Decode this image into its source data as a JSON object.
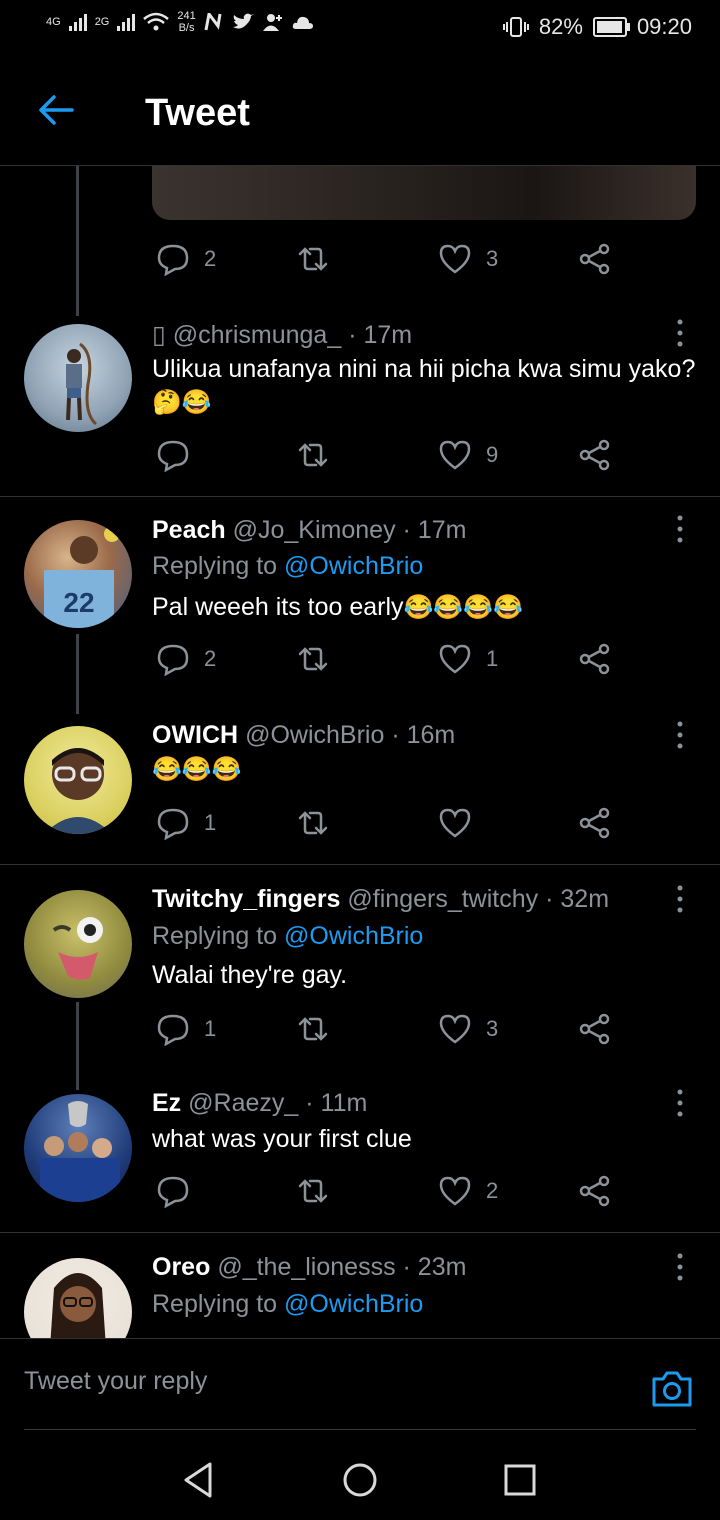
{
  "status_bar": {
    "network1": "4G",
    "network2": "2G",
    "data_rate": "241",
    "data_unit": "B/s",
    "battery": "82%",
    "time": "09:20"
  },
  "header": {
    "title": "Tweet"
  },
  "top_tweet_actions": {
    "replies": "2",
    "likes": "3"
  },
  "tweets": [
    {
      "name": "",
      "handle": "@chrismunga_",
      "prefix": "▯",
      "time": "· 17m",
      "replying_label": "",
      "replying_handle": "",
      "text": "Ulikua unafanya nini na hii picha kwa simu yako?",
      "emoji": "🤔😂",
      "replies": "",
      "likes": "9"
    },
    {
      "name": "Peach",
      "handle": "@Jo_Kimoney",
      "time": "· 17m",
      "replying_label": "Replying to",
      "replying_handle": "@OwichBrio",
      "text": "Pal weeeh its too early",
      "emoji": "😂😂😂😂",
      "replies": "2",
      "likes": "1"
    },
    {
      "name": "OWICH",
      "handle": "@OwichBrio",
      "time": "· 16m",
      "replying_label": "",
      "replying_handle": "",
      "text": "",
      "emoji": "😂😂😂",
      "replies": "1",
      "likes": ""
    },
    {
      "name": "Twitchy_fingers",
      "handle": "@fingers_twitchy",
      "time": "· 32m",
      "replying_label": "Replying to",
      "replying_handle": "@OwichBrio",
      "text": "Walai they're gay.",
      "emoji": "",
      "replies": "1",
      "likes": "3"
    },
    {
      "name": "Ez",
      "handle": "@Raezy_",
      "time": "· 11m",
      "replying_label": "",
      "replying_handle": "",
      "text": "what was your first clue",
      "emoji": "",
      "replies": "",
      "likes": "2"
    },
    {
      "name": "Oreo",
      "handle": "@_the_lionesss",
      "time": "· 23m",
      "replying_label": "Replying to",
      "replying_handle": "@OwichBrio",
      "text": "",
      "emoji": "",
      "replies": "",
      "likes": ""
    }
  ],
  "reply_bar": {
    "placeholder": "Tweet your reply"
  },
  "icons": {
    "back": "arrow-left-icon",
    "reply": "comment-icon",
    "retweet": "retweet-icon",
    "like": "heart-icon",
    "share": "share-icon",
    "more": "more-vertical-icon",
    "camera": "camera-icon",
    "nav_back": "triangle-back-icon",
    "nav_home": "circle-home-icon",
    "nav_recent": "square-recent-icon"
  },
  "colors": {
    "accent": "#1d9bf0",
    "background": "#000000",
    "muted": "#8b9298",
    "divider": "#2f3336"
  }
}
